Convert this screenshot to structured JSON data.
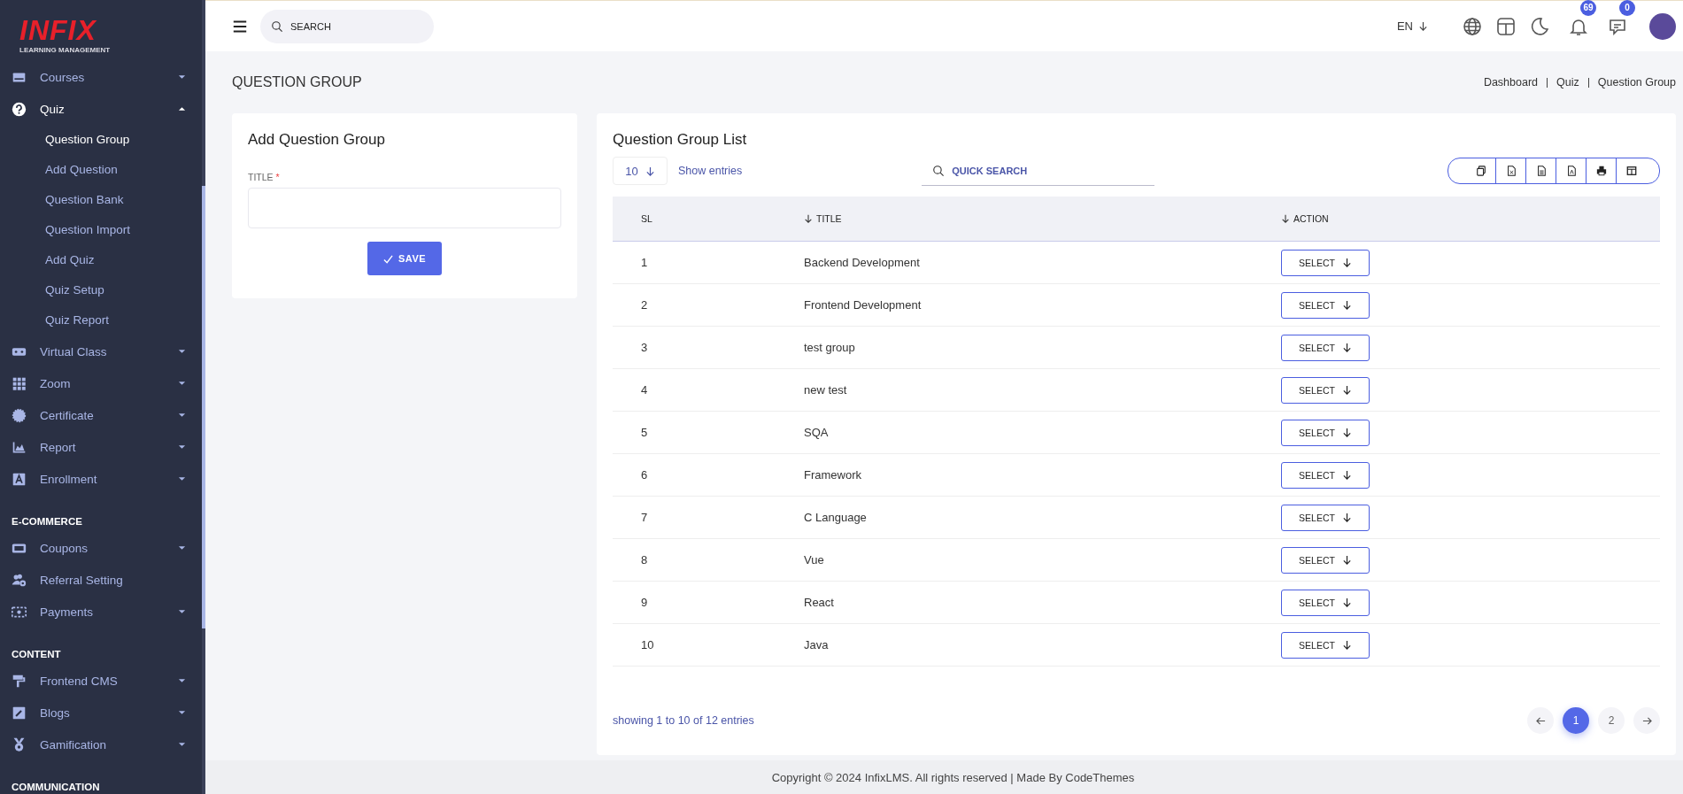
{
  "logo": {
    "wordmark": "INFIX",
    "tagline": "LEARNING MANAGEMENT"
  },
  "sidebar": {
    "items": [
      {
        "kind": "dropdown",
        "label": "Courses",
        "expanded": false
      },
      {
        "kind": "dropdown",
        "label": "Quiz",
        "expanded": true,
        "children": [
          {
            "label": "Question Group",
            "selected": true
          },
          {
            "label": "Add Question",
            "selected": false
          },
          {
            "label": "Question Bank",
            "selected": false
          },
          {
            "label": "Question Import",
            "selected": false
          },
          {
            "label": "Add Quiz",
            "selected": false
          },
          {
            "label": "Quiz Setup",
            "selected": false
          },
          {
            "label": "Quiz Report",
            "selected": false
          }
        ]
      },
      {
        "kind": "dropdown",
        "label": "Virtual Class",
        "expanded": false
      },
      {
        "kind": "dropdown",
        "label": "Zoom",
        "expanded": false
      },
      {
        "kind": "dropdown",
        "label": "Certificate",
        "expanded": false
      },
      {
        "kind": "dropdown",
        "label": "Report",
        "expanded": false
      },
      {
        "kind": "dropdown",
        "label": "Enrollment",
        "expanded": false
      },
      {
        "kind": "section",
        "label": "E-COMMERCE"
      },
      {
        "kind": "dropdown",
        "label": "Coupons",
        "expanded": false
      },
      {
        "kind": "link",
        "label": "Referral Setting"
      },
      {
        "kind": "dropdown",
        "label": "Payments",
        "expanded": false
      },
      {
        "kind": "section",
        "label": "CONTENT"
      },
      {
        "kind": "dropdown",
        "label": "Frontend CMS",
        "expanded": false
      },
      {
        "kind": "dropdown",
        "label": "Blogs",
        "expanded": false
      },
      {
        "kind": "dropdown",
        "label": "Gamification",
        "expanded": false
      },
      {
        "kind": "section",
        "label": "COMMUNICATION"
      }
    ]
  },
  "topbar": {
    "search": {
      "placeholder": "SEARCH"
    },
    "language": "EN",
    "notifications_count": "69",
    "messages_count": "0"
  },
  "page": {
    "title": "QUESTION GROUP",
    "breadcrumb": [
      "Dashboard",
      "Quiz",
      "Question Group"
    ]
  },
  "add_form": {
    "title": "Add Question Group",
    "field_label": "TITLE",
    "required_mark": "*",
    "save_button": "SAVE"
  },
  "list": {
    "title": "Question Group List",
    "page_size": "10",
    "page_size_label": "Show entries",
    "search_placeholder": "QUICK SEARCH",
    "columns": [
      "SL",
      "TITLE",
      "ACTION"
    ],
    "rows": [
      {
        "sl": "1",
        "title": "Backend Development",
        "action": "SELECT"
      },
      {
        "sl": "2",
        "title": "Frontend Development",
        "action": "SELECT"
      },
      {
        "sl": "3",
        "title": "test group",
        "action": "SELECT"
      },
      {
        "sl": "4",
        "title": "new test",
        "action": "SELECT"
      },
      {
        "sl": "5",
        "title": "SQA",
        "action": "SELECT"
      },
      {
        "sl": "6",
        "title": "Framework",
        "action": "SELECT"
      },
      {
        "sl": "7",
        "title": "C Language",
        "action": "SELECT"
      },
      {
        "sl": "8",
        "title": "Vue",
        "action": "SELECT"
      },
      {
        "sl": "9",
        "title": "React",
        "action": "SELECT"
      },
      {
        "sl": "10",
        "title": "Java",
        "action": "SELECT"
      }
    ],
    "summary": "showing 1 to 10 of 12 entries",
    "pages": [
      {
        "label": "1",
        "selected": true
      },
      {
        "label": "2",
        "selected": false
      }
    ]
  },
  "footer": {
    "copyright": "Copyright © 2024 InfixLMS. All rights reserved | Made By CodeThemes"
  }
}
